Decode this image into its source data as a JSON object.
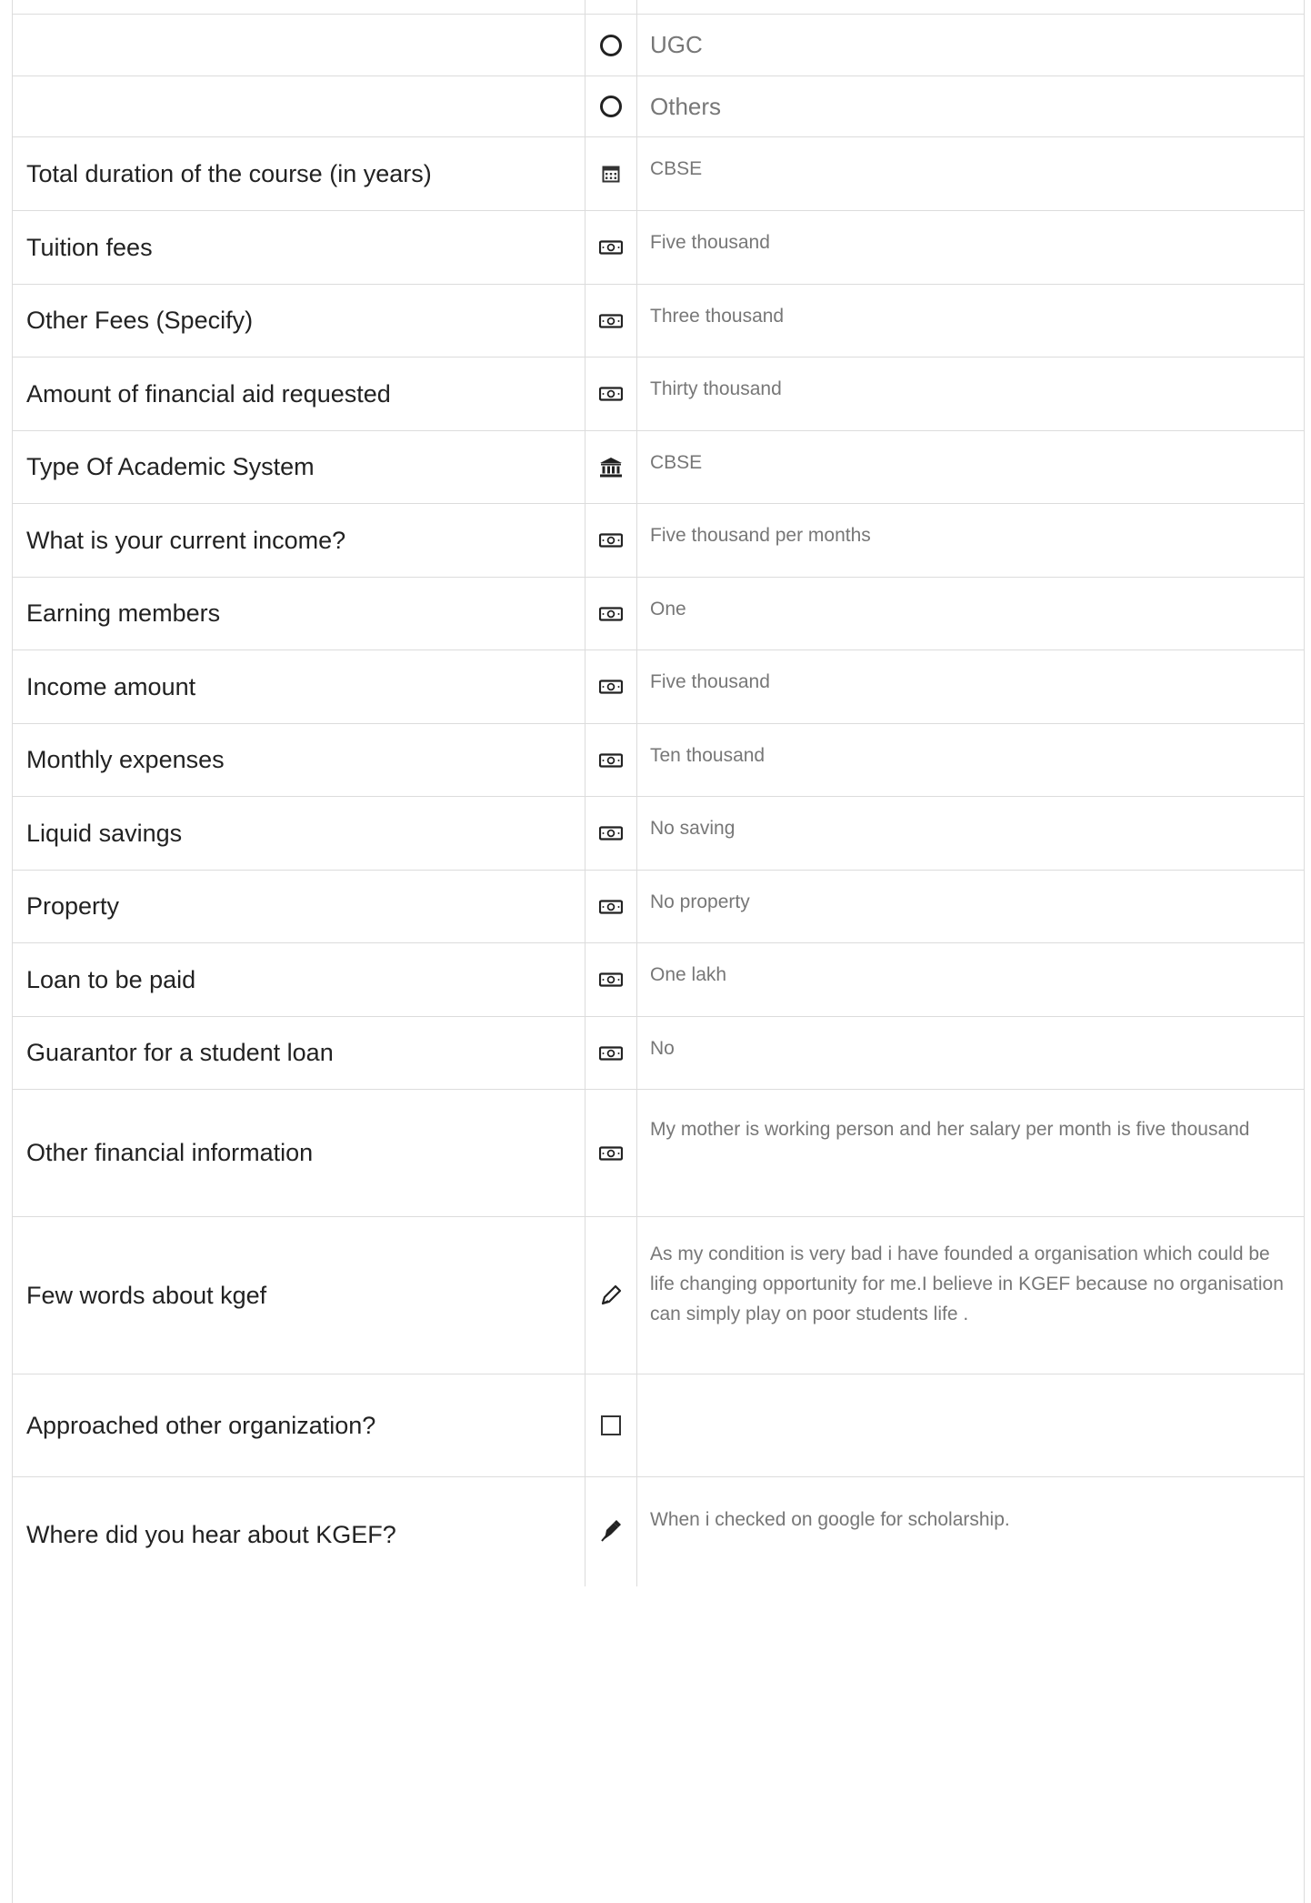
{
  "options": [
    {
      "label": "UGC"
    },
    {
      "label": "Others"
    }
  ],
  "fields": [
    {
      "label": "Total duration of the course (in years)",
      "value": "CBSE",
      "icon": "calendar-icon"
    },
    {
      "label": "Tuition fees",
      "value": "Five thousand",
      "icon": "money-icon"
    },
    {
      "label": "Other Fees (Specify)",
      "value": "Three thousand",
      "icon": "money-icon"
    },
    {
      "label": "Amount of financial aid requested",
      "value": "Thirty thousand",
      "icon": "money-icon"
    },
    {
      "label": "Type Of Academic System",
      "value": "CBSE",
      "icon": "institution-icon"
    },
    {
      "label": "What is your current income?",
      "value": "Five thousand per months",
      "icon": "money-icon"
    },
    {
      "label": "Earning members",
      "value": "One",
      "icon": "money-icon"
    },
    {
      "label": "Income amount",
      "value": "Five thousand",
      "icon": "money-icon"
    },
    {
      "label": "Monthly expenses",
      "value": "Ten thousand",
      "icon": "money-icon"
    },
    {
      "label": "Liquid savings",
      "value": "No saving",
      "icon": "money-icon"
    },
    {
      "label": "Property",
      "value": "No property",
      "icon": "money-icon"
    },
    {
      "label": "Loan to be paid",
      "value": "One lakh",
      "icon": "money-icon"
    },
    {
      "label": "Guarantor for a student loan",
      "value": "No",
      "icon": "money-icon"
    },
    {
      "label": "Other financial information",
      "value": "My mother is working person and her salary per month is five thousand",
      "icon": "money-icon"
    },
    {
      "label": "Few words about kgef",
      "value": "As my condition is very bad i have founded a organisation which could be life changing opportunity for me.I believe in KGEF because no organisation can simply play on poor students life .",
      "icon": "pencil-icon"
    },
    {
      "label": "Approached other organization?",
      "value": "",
      "icon": "checkbox"
    },
    {
      "label": "Where did you hear about KGEF?",
      "value": "When i checked on google for scholarship.",
      "icon": "pen-icon"
    }
  ]
}
